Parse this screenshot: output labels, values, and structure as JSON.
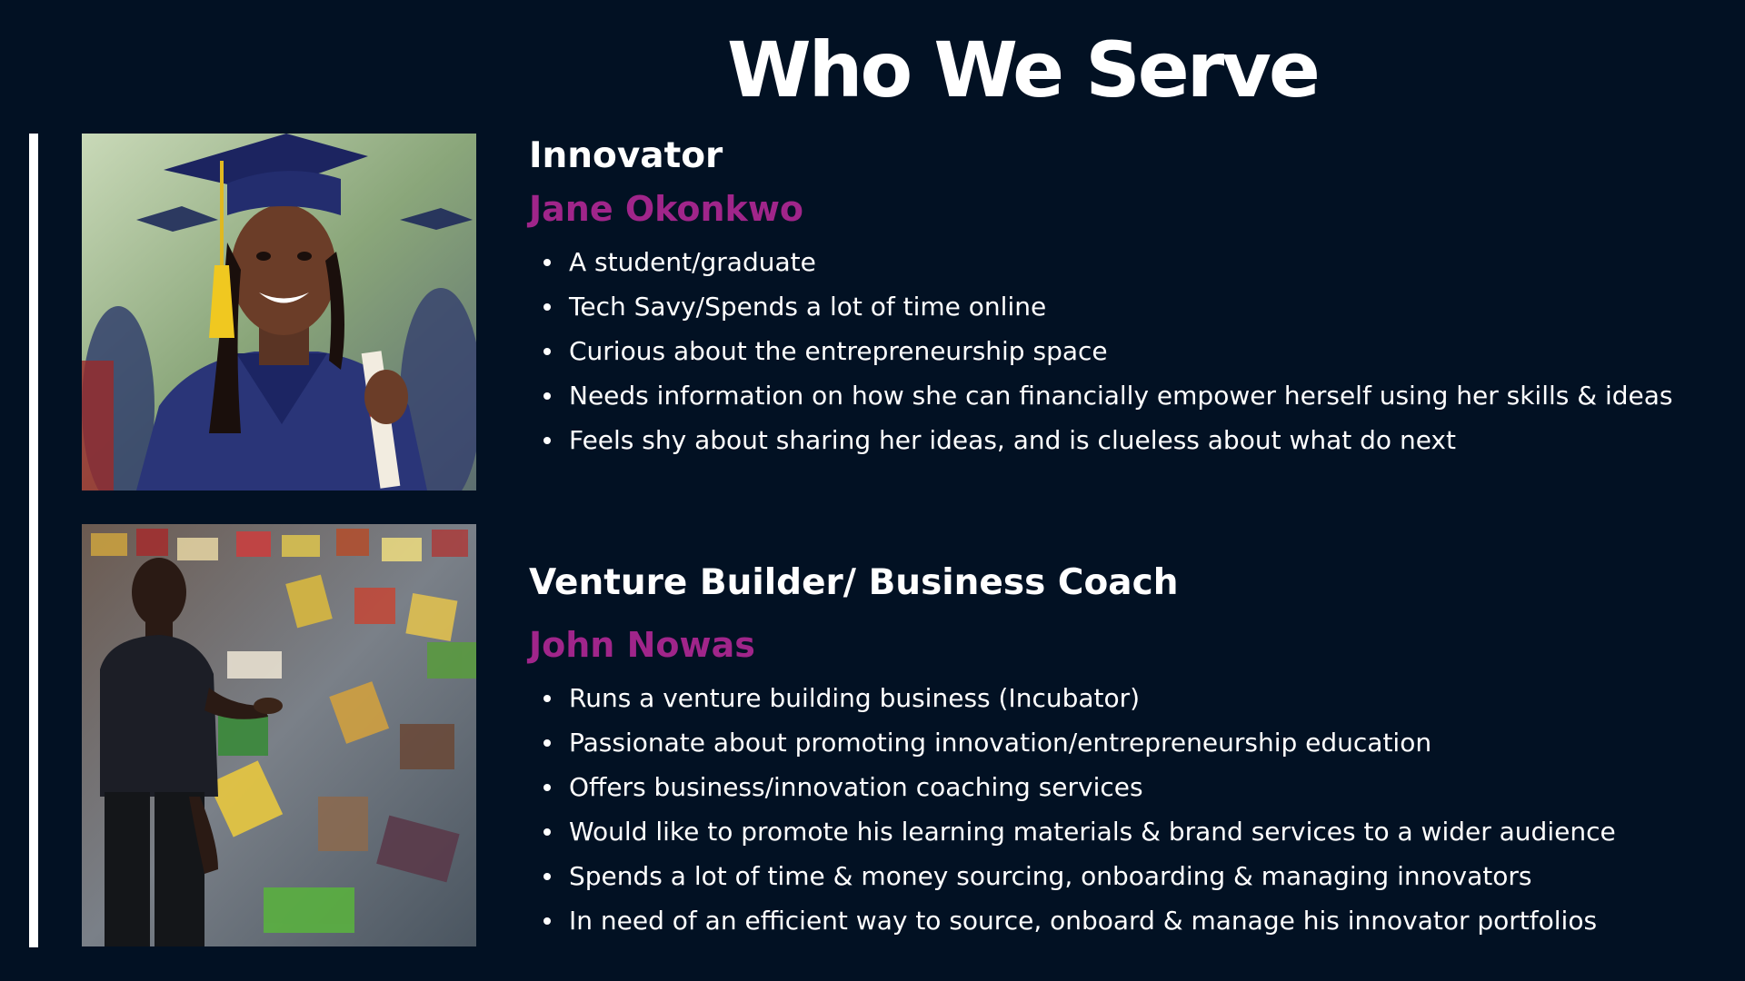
{
  "title": "Who We Serve",
  "personas": [
    {
      "role": "Innovator",
      "name": "Jane Okonkwo",
      "photo_icon": "graduate-photo",
      "bullets": [
        "A student/graduate",
        "Tech Savy/Spends a lot of time online",
        "Curious about the entrepreneurship space",
        "Needs information on how she can financially empower herself using her skills & ideas",
        "Feels shy about sharing her ideas, and is clueless about what do next"
      ]
    },
    {
      "role": "Venture Builder/ Business Coach",
      "name": "John Nowas",
      "photo_icon": "speaker-photo",
      "bullets": [
        "Runs a venture building business (Incubator)",
        "Passionate about promoting innovation/entrepreneurship education",
        "Offers business/innovation coaching services",
        "Would like to promote his learning materials & brand services to a wider audience",
        "Spends a lot of time & money sourcing, onboarding & managing innovators",
        "In need of an efficient way to source, onboard & manage his innovator portfolios"
      ]
    }
  ],
  "colors": {
    "background": "#021123",
    "text": "#ffffff",
    "accent_name": "#a0258a"
  }
}
